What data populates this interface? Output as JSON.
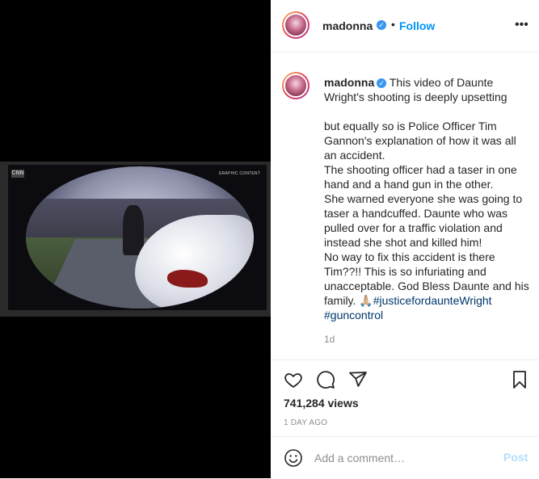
{
  "post": {
    "media": {
      "logo": "CNN",
      "overlay_tag": "GRAPHIC CONTENT"
    },
    "header": {
      "username": "madonna",
      "verified_icon": "verified-badge-icon",
      "dot": "•",
      "follow_label": "Follow",
      "more_icon": "more-options-icon",
      "more_glyph": "•••"
    },
    "caption": {
      "username": "madonna",
      "intro": "This video of Daunte Wright's shooting is deeply upsetting",
      "para1": "but equally so is Police Officer Tim Gannon's explanation of how it was all an accident.",
      "para2": "The shooting officer had a taser in one hand and a hand gun in the other.",
      "para3": "She warned everyone she was going to taser a handcuffed. Daunte who was pulled over for a traffic violation and instead she shot and killed him!",
      "para4": "No way to fix this accident is there Tim??!! This is so infuriating and unacceptable. God Bless Daunte and his family. 🙏🏼",
      "hashtag1": "#justicefordaunteWright",
      "hashtag2": "#guncontrol",
      "age": "1d"
    },
    "actions": {
      "like_icon": "heart-icon",
      "comment_icon": "comment-bubble-icon",
      "share_icon": "share-paper-plane-icon",
      "save_icon": "bookmark-icon",
      "views": "741,284 views",
      "time_ago": "1 DAY AGO"
    },
    "comment_box": {
      "emoji_icon": "emoji-smiley-icon",
      "placeholder": "Add a comment…",
      "post_label": "Post"
    },
    "colors": {
      "link": "#0095f6",
      "hashtag": "#00376b",
      "muted": "#8e8e8e",
      "post_disabled": "#b2dffc"
    }
  }
}
